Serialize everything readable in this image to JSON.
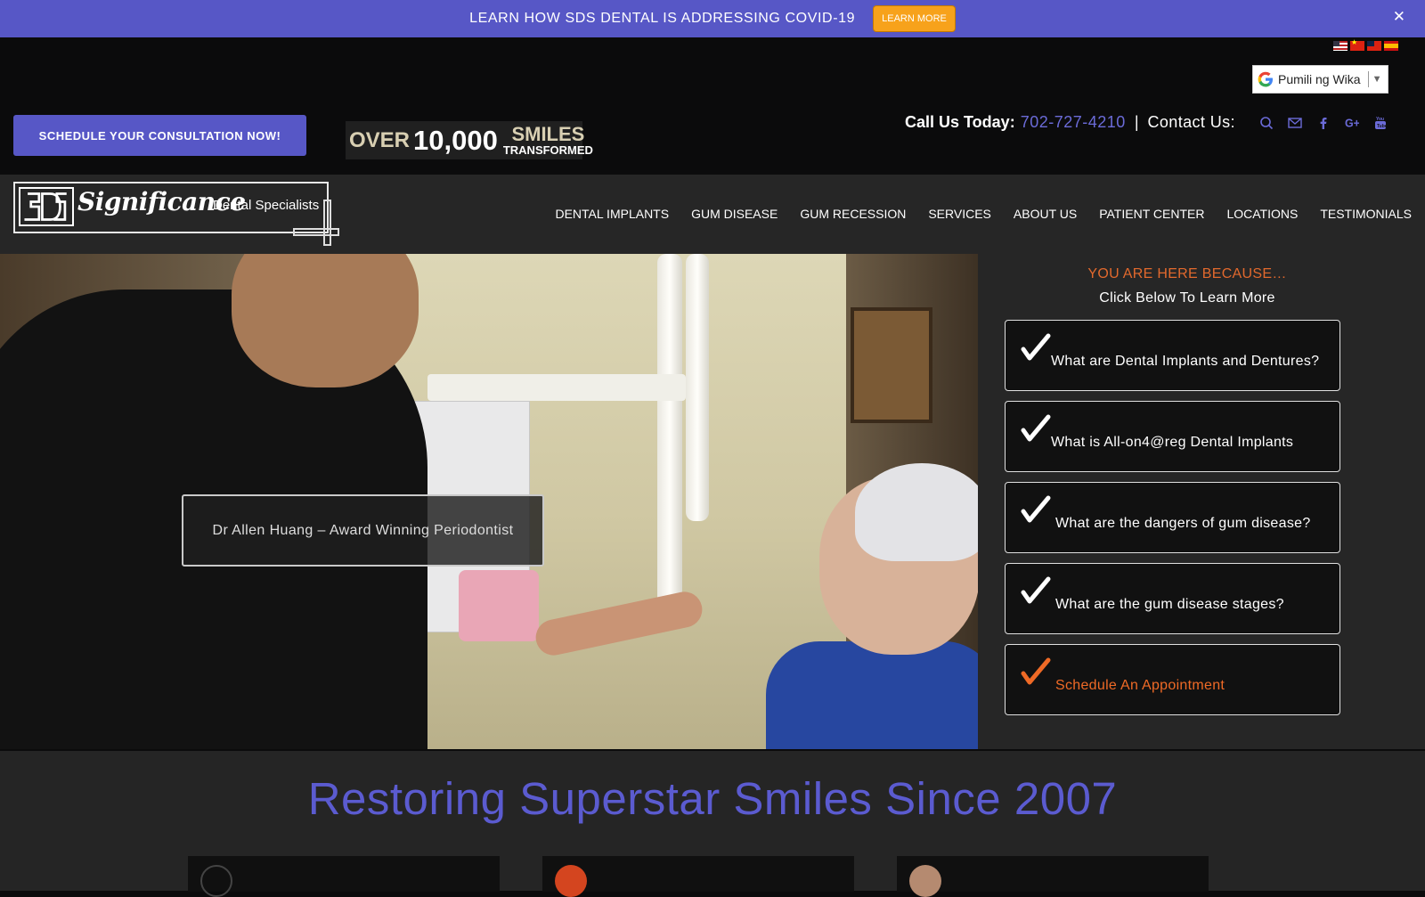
{
  "notice": {
    "text": "LEARN HOW SDS DENTAL IS ADDRESSING COVID-19",
    "button": "LEARN MORE",
    "close": "✕"
  },
  "language": {
    "flags": [
      "us-flag-icon",
      "china-flag-icon",
      "taiwan-flag-icon",
      "spain-flag-icon"
    ],
    "translate_label": "Pumili ng Wika",
    "translate_arrow": "▼"
  },
  "header": {
    "cta": "SCHEDULE YOUR CONSULTATION NOW!",
    "badge": {
      "over": "OVER",
      "number": "10,000",
      "smiles": "SMILES",
      "transformed": "TRANSFORMED"
    },
    "call_label": "Call Us Today:",
    "phone": "702-727-4210",
    "pipe": "|",
    "contact_label": "Contact Us:",
    "icons": [
      "search-icon",
      "mail-icon",
      "facebook-icon",
      "google-plus-icon",
      "youtube-icon"
    ],
    "accent_color": "#5757c6"
  },
  "logo": {
    "name": "Significance",
    "sub": "Dental Specialists"
  },
  "nav": {
    "items": [
      "DENTAL IMPLANTS",
      "GUM DISEASE",
      "GUM RECESSION",
      "SERVICES",
      "ABOUT US",
      "PATIENT CENTER",
      "LOCATIONS",
      "TESTIMONIALS"
    ]
  },
  "hero": {
    "caption": "Dr Allen Huang – Award Winning Periodontist"
  },
  "panel": {
    "kicker": "YOU ARE HERE BECAUSE…",
    "subtitle": "Click Below To Learn More",
    "choices": [
      "What are Dental Implants and Dentures?",
      "What is All-on4@reg Dental Implants",
      "What are the dangers of gum disease?",
      "What are the gum disease stages?",
      "Schedule An Appointment"
    ],
    "kicker_color": "#e2692d"
  },
  "bottom": {
    "title": "Restoring Superstar Smiles Since 2007"
  }
}
